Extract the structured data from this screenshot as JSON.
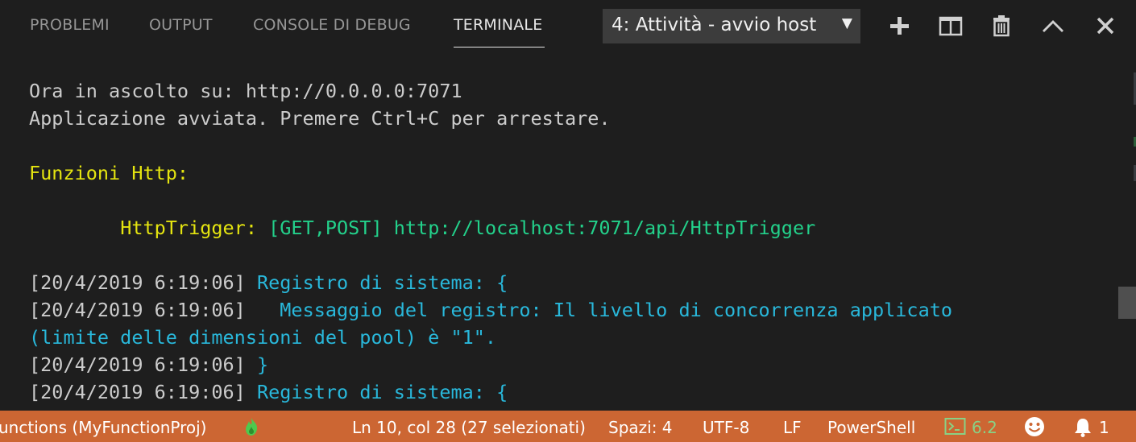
{
  "tabs": {
    "problems": "PROBLEMI",
    "output": "OUTPUT",
    "debug_console": "CONSOLE DI DEBUG",
    "terminal": "TERMINALE"
  },
  "terminal_select": {
    "value": "4: Attività - avvio host"
  },
  "actions": [
    "plus-icon",
    "split-terminal-icon",
    "trash-icon",
    "chevron-up-icon",
    "close-icon"
  ],
  "terminal": {
    "line1": "Ora in ascolto su: http://0.0.0.0:7071",
    "line2": "Applicazione avviata. Premere Ctrl+C per arrestare.",
    "line3": "Funzioni Http:",
    "trigger_name": "HttpTrigger:",
    "trigger_methods": "[GET,POST]",
    "trigger_url": "http://localhost:7071/api/HttpTrigger",
    "log1_ts": "[20/4/2019 6:19:06]",
    "log1_msg": "Registro di sistema: {",
    "log2_ts": "[20/4/2019 6:19:06]",
    "log2_msg": "Messaggio del registro: Il livello di concorrenza applicato",
    "log2_cont": "(limite delle dimensioni del pool) è \"1\".",
    "log3_ts": "[20/4/2019 6:19:06]",
    "log3_msg": "}",
    "log4_ts": "[20/4/2019 6:19:06]",
    "log4_msg": "Registro di sistema: {"
  },
  "statusbar": {
    "project": "unctions (MyFunctionProj)",
    "cursor": "Ln 10, col 28 (27 selezionati)",
    "spaces": "Spazi: 4",
    "encoding": "UTF-8",
    "eol": "LF",
    "language": "PowerShell",
    "ps_version": "6.2",
    "notifications": "1"
  },
  "colors": {
    "panel_bg": "#1e1e1e",
    "statusbar_bg": "#cc6633",
    "ansi_yellow": "#e5e510",
    "ansi_green": "#23d18b",
    "ansi_cyan": "#29b8db"
  }
}
